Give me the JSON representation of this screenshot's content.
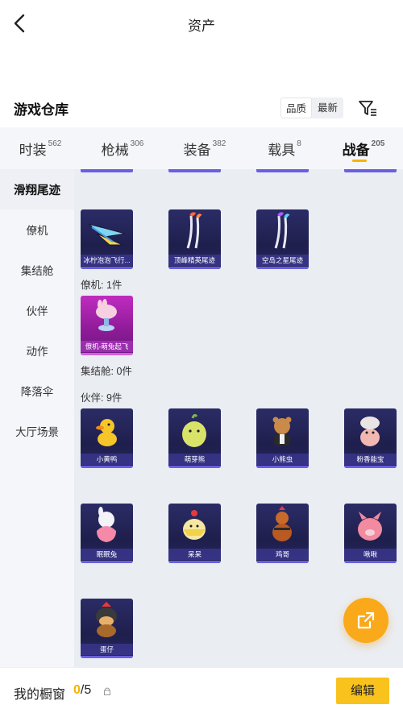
{
  "header": {
    "title": "资产"
  },
  "section": {
    "title": "游戏仓库",
    "sort_options": [
      "品质",
      "最新"
    ]
  },
  "tabs": [
    {
      "label": "时装",
      "count": "562"
    },
    {
      "label": "枪械",
      "count": "306"
    },
    {
      "label": "装备",
      "count": "382"
    },
    {
      "label": "载具",
      "count": "8"
    },
    {
      "label": "战备",
      "count": "205",
      "active": true
    }
  ],
  "sidebar": {
    "items": [
      {
        "label": "滑翔尾迹",
        "active": true
      },
      {
        "label": "僚机"
      },
      {
        "label": "集结舱"
      },
      {
        "label": "伙伴"
      },
      {
        "label": "动作"
      },
      {
        "label": "降落伞"
      },
      {
        "label": "大厅场景"
      }
    ]
  },
  "groups": {
    "trail_items": [
      "冰柠泡泡飞行...",
      "顶峰精英尾迹",
      "空岛之星尾迹"
    ],
    "wingman_label": "僚机: 1件",
    "wingman_items": [
      "僚机-萌兔起飞"
    ],
    "pod_label": "集结舱: 0件",
    "partner_label": "伙伴: 9件",
    "partner_items": [
      "小黄鸭",
      "萌芽熊",
      "小熊虫",
      "粉香能宝",
      "眠眠兔",
      "呆呆",
      "鸡哥",
      "啾啾",
      "蛋仔"
    ]
  },
  "bottom": {
    "label": "我的橱窗",
    "current": "0",
    "total": "/5",
    "edit_label": "编辑"
  },
  "colors": {
    "accent": "#f6b400",
    "fab": "#f9a91a",
    "item_bg": "#23234f",
    "item_stripe": "#6b5fe0"
  }
}
